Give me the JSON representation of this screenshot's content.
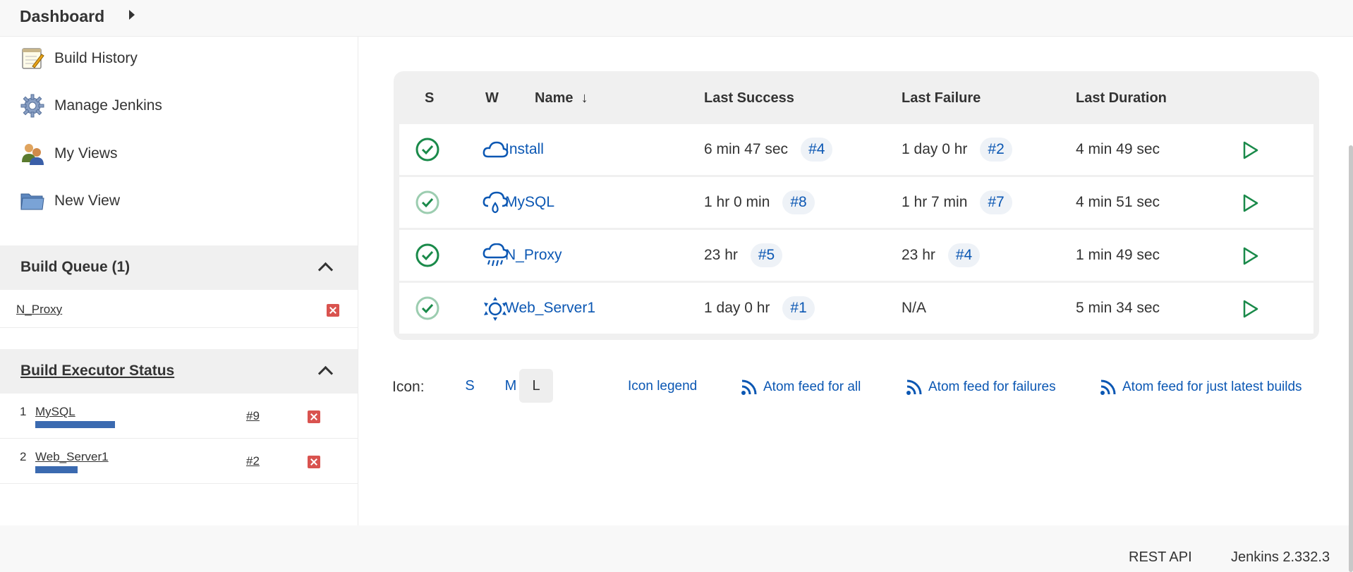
{
  "header": {
    "breadcrumb": "Dashboard"
  },
  "sidebar": {
    "items": [
      {
        "label": "Build History",
        "icon": "notepad-icon"
      },
      {
        "label": "Manage Jenkins",
        "icon": "gear-icon"
      },
      {
        "label": "My Views",
        "icon": "users-icon"
      },
      {
        "label": "New View",
        "icon": "folder-icon"
      }
    ],
    "build_queue": {
      "title": "Build Queue (1)",
      "items": [
        {
          "name": "N_Proxy"
        }
      ]
    },
    "executors": {
      "title": "Build Executor Status",
      "items": [
        {
          "num": "1",
          "name": "MySQL",
          "build": "#9",
          "progress": 0.75
        },
        {
          "num": "2",
          "name": "Web_Server1",
          "build": "#2",
          "progress": 0.4
        }
      ]
    }
  },
  "table": {
    "headers": {
      "s": "S",
      "w": "W",
      "name": "Name",
      "sort": "↓",
      "last_success": "Last Success",
      "last_failure": "Last Failure",
      "last_duration": "Last Duration"
    },
    "rows": [
      {
        "name": "Install",
        "success_time": "6 min 47 sec",
        "success_build": "#4",
        "failure_time": "1 day 0 hr",
        "failure_build": "#2",
        "duration": "4 min 49 sec",
        "weather": "cloud-icon"
      },
      {
        "name": "MySQL",
        "success_time": "1 hr 0 min",
        "success_build": "#8",
        "failure_time": "1 hr 7 min",
        "failure_build": "#7",
        "duration": "4 min 51 sec",
        "weather": "rain-drop-cloud-icon"
      },
      {
        "name": "N_Proxy",
        "success_time": "23 hr",
        "success_build": "#5",
        "failure_time": "23 hr",
        "failure_build": "#4",
        "duration": "1 min 49 sec",
        "weather": "storm-cloud-icon"
      },
      {
        "name": "Web_Server1",
        "success_time": "1 day 0 hr",
        "success_build": "#1",
        "failure_time": "N/A",
        "failure_build": "",
        "duration": "5 min 34 sec",
        "weather": "sun-icon"
      }
    ]
  },
  "icon_bar": {
    "label": "Icon:",
    "sizes": [
      "S",
      "M",
      "L"
    ],
    "active": "L",
    "legend": "Icon legend",
    "feed_all": "Atom feed for all",
    "feed_failures": "Atom feed for failures",
    "feed_latest": "Atom feed for just latest builds"
  },
  "footer": {
    "rest_api": "REST API",
    "version": "Jenkins 2.332.3"
  },
  "colors": {
    "link": "#0b57b3",
    "success": "#1a8a4a",
    "progress": "#3b6ab0",
    "cancel": "#d9534f"
  }
}
